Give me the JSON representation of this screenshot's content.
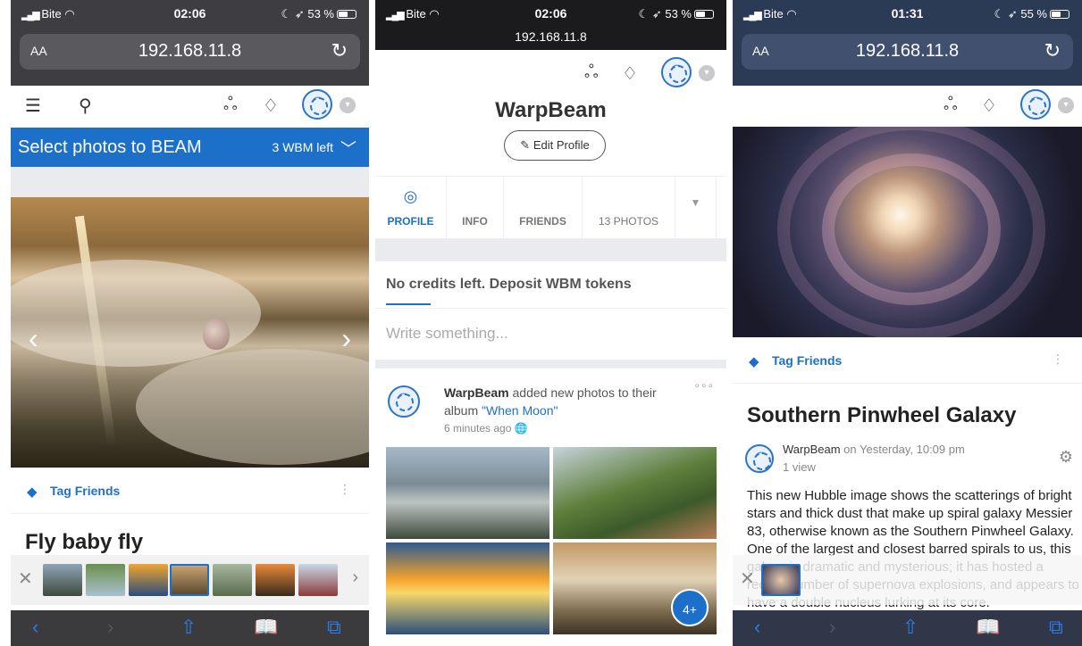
{
  "panel1": {
    "status": {
      "carrier": "Bite",
      "time": "02:06",
      "battery": "53 %"
    },
    "url": "192.168.11.8",
    "text_size": "AA",
    "banner": {
      "title": "Select photos to BEAM",
      "credits": "3 WBM left"
    },
    "tag_label": "Tag Friends",
    "photo_title": "Fly baby fly"
  },
  "panel2": {
    "status": {
      "carrier": "Bite",
      "time": "02:06",
      "battery": "53 %"
    },
    "url": "192.168.11.8",
    "profile_name": "WarpBeam",
    "edit_profile": "Edit Profile",
    "tabs": [
      {
        "label": "PROFILE"
      },
      {
        "label": "INFO"
      },
      {
        "label": "FRIENDS"
      },
      {
        "label": "13 PHOTOS"
      }
    ],
    "no_credits": "No credits left. Deposit WBM tokens",
    "write_placeholder": "Write something...",
    "post": {
      "author": "WarpBeam",
      "action": "added new photos to their album",
      "album": "\"When Moon\"",
      "time": "6 minutes ago",
      "more_count": "4+"
    }
  },
  "panel3": {
    "status": {
      "carrier": "Bite",
      "time": "01:31",
      "battery": "55 %"
    },
    "url": "192.168.11.8",
    "text_size": "AA",
    "tag_label": "Tag Friends",
    "title": "Southern Pinwheel Galaxy",
    "author": "WarpBeam",
    "posted": "on Yesterday, 10:09 pm",
    "views": "1 view",
    "description": "This new Hubble image shows the scatterings of bright stars and thick dust that make up spiral galaxy Messier 83, otherwise known as the Southern Pinwheel Galaxy. One of the largest and closest barred spirals to us, this galaxy is dramatic and mysterious; it has hosted a record number of supernova explosions, and appears to have a double nucleus lurking at its core."
  },
  "colors": {
    "accent": "#1d70c9",
    "safari_bar": "#3b3b3e",
    "url_bar": "#5a5a5e"
  }
}
